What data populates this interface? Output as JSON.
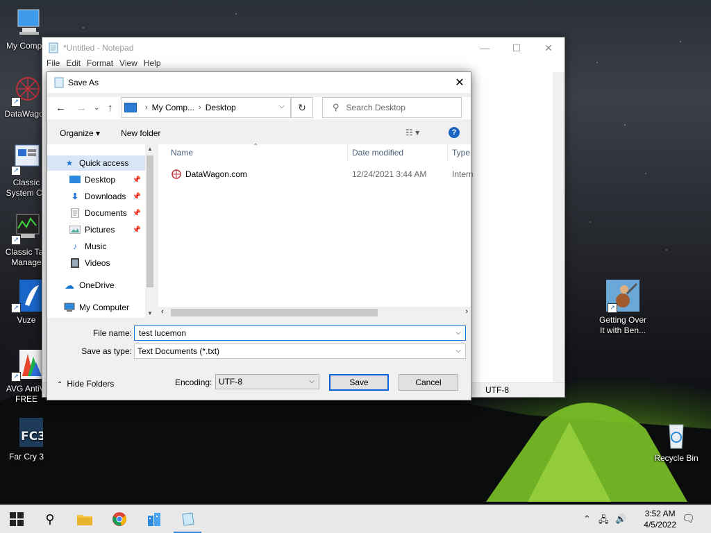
{
  "desktop": {
    "icons": [
      {
        "label": "My Compu",
        "name": "my-computer"
      },
      {
        "label": "DataWagon",
        "name": "datawagon"
      },
      {
        "label": "Classic System Co",
        "name": "classic-system-config"
      },
      {
        "label": "Classic Tas Manage",
        "name": "classic-task-manager"
      },
      {
        "label": "Vuze",
        "name": "vuze"
      },
      {
        "label": "AVG AntiVi FREE",
        "name": "avg-antivirus"
      },
      {
        "label": "Far Cry 3",
        "name": "far-cry-3"
      },
      {
        "label": "Getting Over It with Ben...",
        "name": "getting-over-it"
      },
      {
        "label": "Recycle Bin",
        "name": "recycle-bin"
      }
    ]
  },
  "notepad": {
    "title": "*Untitled - Notepad",
    "menu": [
      "File",
      "Edit",
      "Format",
      "View",
      "Help"
    ],
    "status_encoding": "UTF-8"
  },
  "dialog": {
    "title": "Save As",
    "address": {
      "seg1": "My Comp...",
      "seg2": "Desktop"
    },
    "search_placeholder": "Search Desktop",
    "toolbar": {
      "organize": "Organize",
      "new_folder": "New folder"
    },
    "nav": [
      {
        "label": "Quick access",
        "pinned": false
      },
      {
        "label": "Desktop",
        "pinned": true
      },
      {
        "label": "Downloads",
        "pinned": true
      },
      {
        "label": "Documents",
        "pinned": true
      },
      {
        "label": "Pictures",
        "pinned": true
      },
      {
        "label": "Music",
        "pinned": false
      },
      {
        "label": "Videos",
        "pinned": false
      },
      {
        "label": "OneDrive",
        "pinned": false
      },
      {
        "label": "My Computer",
        "pinned": false
      }
    ],
    "columns": {
      "name": "Name",
      "date": "Date modified",
      "type": "Type"
    },
    "files": [
      {
        "name": "DataWagon.com",
        "date": "12/24/2021 3:44 AM",
        "type": "Intern"
      }
    ],
    "file_name_label": "File name:",
    "file_name_value": "test lucemon",
    "save_type_label": "Save as type:",
    "save_type_value": "Text Documents (*.txt)",
    "hide_folders": "Hide Folders",
    "encoding_label": "Encoding:",
    "encoding_value": "UTF-8",
    "save_button": "Save",
    "cancel_button": "Cancel"
  },
  "taskbar": {
    "time": "3:52 AM",
    "date": "4/5/2022"
  }
}
